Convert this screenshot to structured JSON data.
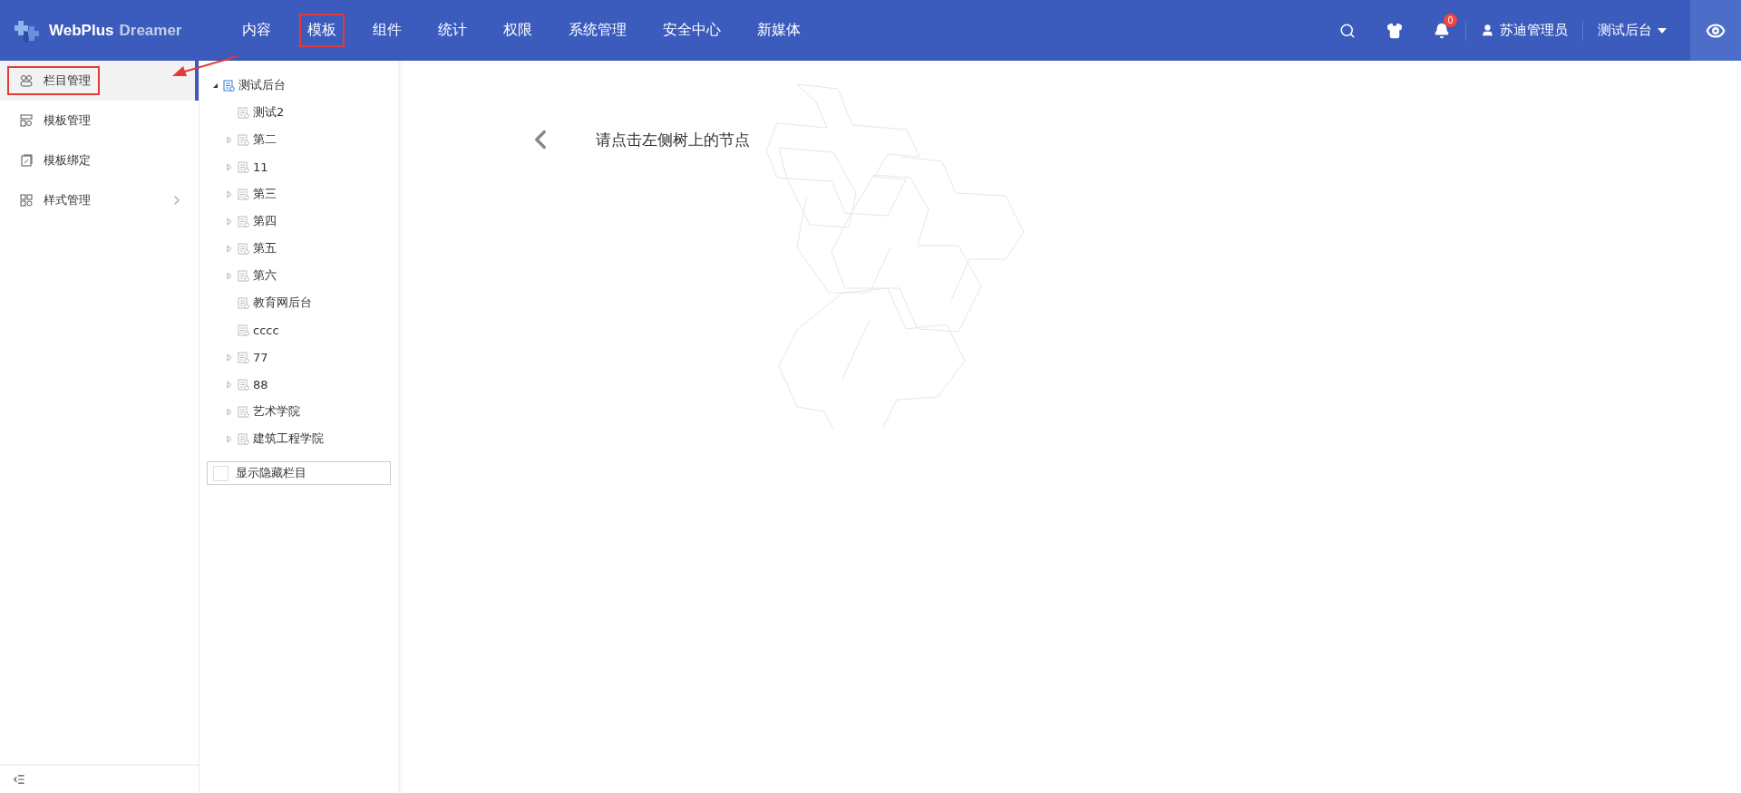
{
  "brand": {
    "name": "WebPlus",
    "subtitle": "Dreamer"
  },
  "nav": [
    {
      "label": "内容",
      "highlighted": false
    },
    {
      "label": "模板",
      "highlighted": true
    },
    {
      "label": "组件",
      "highlighted": false
    },
    {
      "label": "统计",
      "highlighted": false
    },
    {
      "label": "权限",
      "highlighted": false
    },
    {
      "label": "系统管理",
      "highlighted": false
    },
    {
      "label": "安全中心",
      "highlighted": false
    },
    {
      "label": "新媒体",
      "highlighted": false
    }
  ],
  "header": {
    "notifications": "0",
    "user": "苏迪管理员",
    "site": "测试后台"
  },
  "sidebar": {
    "items": [
      {
        "label": "栏目管理",
        "selected": true,
        "highlighted": true,
        "has_submenu": false
      },
      {
        "label": "模板管理",
        "selected": false,
        "highlighted": false,
        "has_submenu": false
      },
      {
        "label": "模板绑定",
        "selected": false,
        "highlighted": false,
        "has_submenu": false
      },
      {
        "label": "样式管理",
        "selected": false,
        "highlighted": false,
        "has_submenu": true
      }
    ]
  },
  "tree": {
    "label": "测试后台",
    "kind": "folder",
    "expanded": true,
    "children": [
      {
        "label": "测试2",
        "kind": "leaf"
      },
      {
        "label": "第二",
        "kind": "folder",
        "expanded": false
      },
      {
        "label": "11",
        "kind": "folder",
        "expanded": false
      },
      {
        "label": "第三",
        "kind": "folder",
        "expanded": false
      },
      {
        "label": "第四",
        "kind": "folder",
        "expanded": false
      },
      {
        "label": "第五",
        "kind": "folder",
        "expanded": false
      },
      {
        "label": "第六",
        "kind": "folder",
        "expanded": false
      },
      {
        "label": "教育网后台",
        "kind": "leaf"
      },
      {
        "label": "cccc",
        "kind": "leaf"
      },
      {
        "label": "77",
        "kind": "folder",
        "expanded": false
      },
      {
        "label": "88",
        "kind": "folder",
        "expanded": false
      },
      {
        "label": "艺术学院",
        "kind": "folder",
        "expanded": false
      },
      {
        "label": "建筑工程学院",
        "kind": "folder",
        "expanded": false
      }
    ]
  },
  "show_hidden": {
    "label": "显示隐藏栏目",
    "checked": false
  },
  "message": "请点击左侧树上的节点"
}
